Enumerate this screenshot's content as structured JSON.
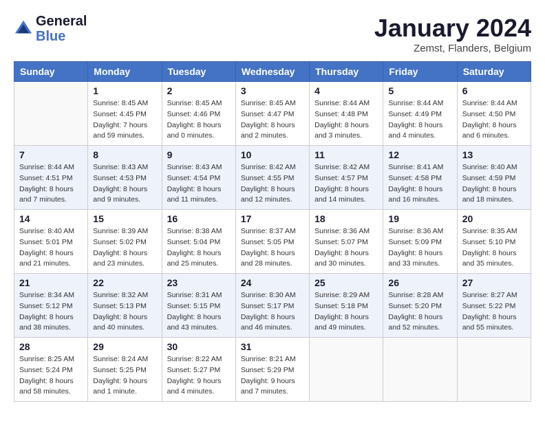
{
  "header": {
    "logo_line1": "General",
    "logo_line2": "Blue",
    "month": "January 2024",
    "location": "Zemst, Flanders, Belgium"
  },
  "weekdays": [
    "Sunday",
    "Monday",
    "Tuesday",
    "Wednesday",
    "Thursday",
    "Friday",
    "Saturday"
  ],
  "weeks": [
    [
      {
        "day": "",
        "info": ""
      },
      {
        "day": "1",
        "info": "Sunrise: 8:45 AM\nSunset: 4:45 PM\nDaylight: 7 hours\nand 59 minutes."
      },
      {
        "day": "2",
        "info": "Sunrise: 8:45 AM\nSunset: 4:46 PM\nDaylight: 8 hours\nand 0 minutes."
      },
      {
        "day": "3",
        "info": "Sunrise: 8:45 AM\nSunset: 4:47 PM\nDaylight: 8 hours\nand 2 minutes."
      },
      {
        "day": "4",
        "info": "Sunrise: 8:44 AM\nSunset: 4:48 PM\nDaylight: 8 hours\nand 3 minutes."
      },
      {
        "day": "5",
        "info": "Sunrise: 8:44 AM\nSunset: 4:49 PM\nDaylight: 8 hours\nand 4 minutes."
      },
      {
        "day": "6",
        "info": "Sunrise: 8:44 AM\nSunset: 4:50 PM\nDaylight: 8 hours\nand 6 minutes."
      }
    ],
    [
      {
        "day": "7",
        "info": "Sunrise: 8:44 AM\nSunset: 4:51 PM\nDaylight: 8 hours\nand 7 minutes."
      },
      {
        "day": "8",
        "info": "Sunrise: 8:43 AM\nSunset: 4:53 PM\nDaylight: 8 hours\nand 9 minutes."
      },
      {
        "day": "9",
        "info": "Sunrise: 8:43 AM\nSunset: 4:54 PM\nDaylight: 8 hours\nand 11 minutes."
      },
      {
        "day": "10",
        "info": "Sunrise: 8:42 AM\nSunset: 4:55 PM\nDaylight: 8 hours\nand 12 minutes."
      },
      {
        "day": "11",
        "info": "Sunrise: 8:42 AM\nSunset: 4:57 PM\nDaylight: 8 hours\nand 14 minutes."
      },
      {
        "day": "12",
        "info": "Sunrise: 8:41 AM\nSunset: 4:58 PM\nDaylight: 8 hours\nand 16 minutes."
      },
      {
        "day": "13",
        "info": "Sunrise: 8:40 AM\nSunset: 4:59 PM\nDaylight: 8 hours\nand 18 minutes."
      }
    ],
    [
      {
        "day": "14",
        "info": "Sunrise: 8:40 AM\nSunset: 5:01 PM\nDaylight: 8 hours\nand 21 minutes."
      },
      {
        "day": "15",
        "info": "Sunrise: 8:39 AM\nSunset: 5:02 PM\nDaylight: 8 hours\nand 23 minutes."
      },
      {
        "day": "16",
        "info": "Sunrise: 8:38 AM\nSunset: 5:04 PM\nDaylight: 8 hours\nand 25 minutes."
      },
      {
        "day": "17",
        "info": "Sunrise: 8:37 AM\nSunset: 5:05 PM\nDaylight: 8 hours\nand 28 minutes."
      },
      {
        "day": "18",
        "info": "Sunrise: 8:36 AM\nSunset: 5:07 PM\nDaylight: 8 hours\nand 30 minutes."
      },
      {
        "day": "19",
        "info": "Sunrise: 8:36 AM\nSunset: 5:09 PM\nDaylight: 8 hours\nand 33 minutes."
      },
      {
        "day": "20",
        "info": "Sunrise: 8:35 AM\nSunset: 5:10 PM\nDaylight: 8 hours\nand 35 minutes."
      }
    ],
    [
      {
        "day": "21",
        "info": "Sunrise: 8:34 AM\nSunset: 5:12 PM\nDaylight: 8 hours\nand 38 minutes."
      },
      {
        "day": "22",
        "info": "Sunrise: 8:32 AM\nSunset: 5:13 PM\nDaylight: 8 hours\nand 40 minutes."
      },
      {
        "day": "23",
        "info": "Sunrise: 8:31 AM\nSunset: 5:15 PM\nDaylight: 8 hours\nand 43 minutes."
      },
      {
        "day": "24",
        "info": "Sunrise: 8:30 AM\nSunset: 5:17 PM\nDaylight: 8 hours\nand 46 minutes."
      },
      {
        "day": "25",
        "info": "Sunrise: 8:29 AM\nSunset: 5:18 PM\nDaylight: 8 hours\nand 49 minutes."
      },
      {
        "day": "26",
        "info": "Sunrise: 8:28 AM\nSunset: 5:20 PM\nDaylight: 8 hours\nand 52 minutes."
      },
      {
        "day": "27",
        "info": "Sunrise: 8:27 AM\nSunset: 5:22 PM\nDaylight: 8 hours\nand 55 minutes."
      }
    ],
    [
      {
        "day": "28",
        "info": "Sunrise: 8:25 AM\nSunset: 5:24 PM\nDaylight: 8 hours\nand 58 minutes."
      },
      {
        "day": "29",
        "info": "Sunrise: 8:24 AM\nSunset: 5:25 PM\nDaylight: 9 hours\nand 1 minute."
      },
      {
        "day": "30",
        "info": "Sunrise: 8:22 AM\nSunset: 5:27 PM\nDaylight: 9 hours\nand 4 minutes."
      },
      {
        "day": "31",
        "info": "Sunrise: 8:21 AM\nSunset: 5:29 PM\nDaylight: 9 hours\nand 7 minutes."
      },
      {
        "day": "",
        "info": ""
      },
      {
        "day": "",
        "info": ""
      },
      {
        "day": "",
        "info": ""
      }
    ]
  ]
}
